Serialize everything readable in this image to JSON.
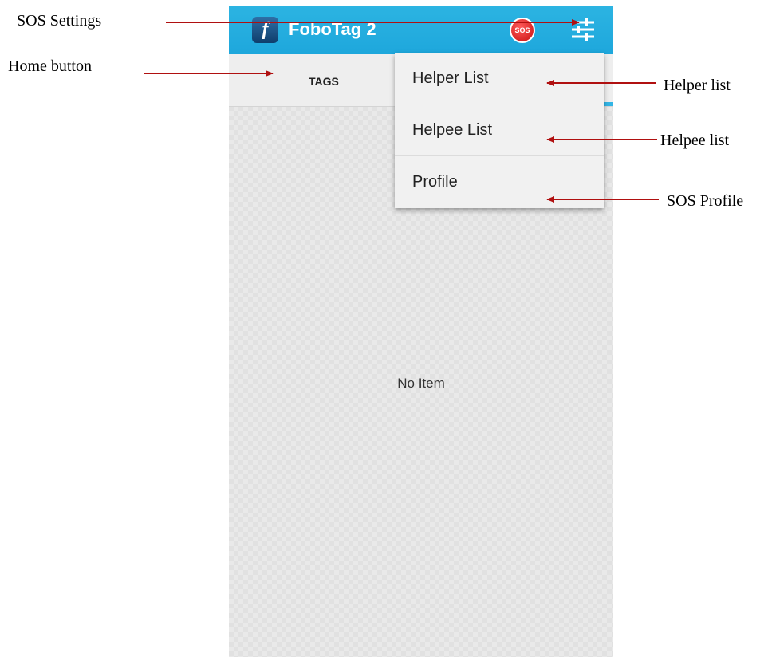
{
  "annotations": {
    "sos_settings": "SOS Settings",
    "home_button": "Home button",
    "helper_list": "Helper list",
    "helpee_list": "Helpee list",
    "sos_profile": "SOS Profile"
  },
  "appbar": {
    "title": "FoboTag 2",
    "logo_glyph": "f",
    "sos_label": "SOS",
    "settings_icon": "sliders-icon"
  },
  "tabs": {
    "tags_label": "TAGS"
  },
  "menu": {
    "items": [
      {
        "label": "Helper List"
      },
      {
        "label": "Helpee List"
      },
      {
        "label": "Profile"
      }
    ]
  },
  "content": {
    "empty_text": "No Item"
  },
  "colors": {
    "appbar": "#1ea7dc",
    "tab_indicator": "#33b5e5",
    "annotation_arrow": "#b01010",
    "sos": "#d41414"
  }
}
